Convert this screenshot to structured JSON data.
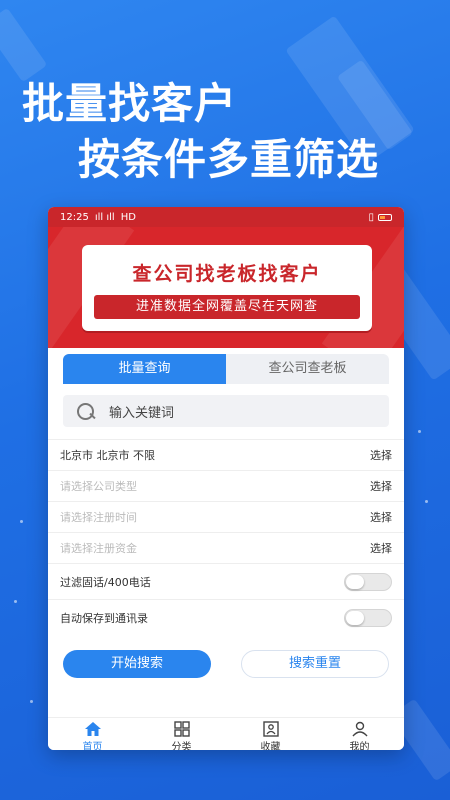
{
  "hero": {
    "line1": "批量找客户",
    "line2": "按条件多重筛选"
  },
  "statusbar": {
    "time": "12:25",
    "signal": "ıll ıll",
    "network": "HD",
    "battery_percent_text": ""
  },
  "banner": {
    "title": "查公司找老板找客户",
    "subtitle": "进准数据全网覆盖尽在天网查"
  },
  "tabs": [
    {
      "label": "批量查询",
      "active": true
    },
    {
      "label": "查公司查老板",
      "active": false
    }
  ],
  "search": {
    "placeholder": "输入关键词"
  },
  "filters": [
    {
      "label": "北京市  北京市  不限",
      "action": "选择",
      "muted": false
    },
    {
      "label": "请选择公司类型",
      "action": "选择",
      "muted": true
    },
    {
      "label": "请选择注册时间",
      "action": "选择",
      "muted": true
    },
    {
      "label": "请选择注册资金",
      "action": "选择",
      "muted": true
    }
  ],
  "toggles": [
    {
      "label": "过滤固话/400电话",
      "on": false
    },
    {
      "label": "自动保存到通讯录",
      "on": false
    }
  ],
  "buttons": {
    "start": "开始搜索",
    "reset": "搜索重置"
  },
  "tabbar": [
    {
      "label": "首页",
      "icon": "home-icon",
      "active": true
    },
    {
      "label": "分类",
      "icon": "grid-icon",
      "active": false
    },
    {
      "label": "收藏",
      "icon": "bookmark-icon",
      "active": false
    },
    {
      "label": "我的",
      "icon": "user-icon",
      "active": false
    }
  ],
  "colors": {
    "primary": "#2a85ee",
    "banner_red": "#d8262b",
    "background": "#1f6fe4"
  }
}
